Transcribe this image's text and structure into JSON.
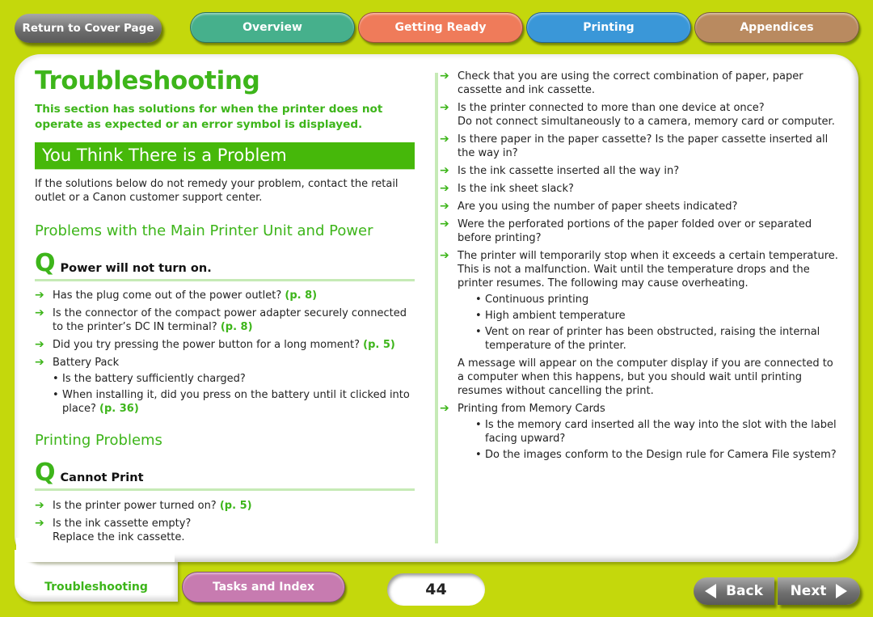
{
  "nav": {
    "return_cover": "Return to Cover Page",
    "tabs": [
      {
        "label": "Overview",
        "color": "#46b08c"
      },
      {
        "label": "Getting Ready",
        "color": "#ef7b5a"
      },
      {
        "label": "Printing",
        "color": "#3a97d8"
      },
      {
        "label": "Appendices",
        "color": "#b98a60"
      }
    ]
  },
  "page": {
    "title": "Troubleshooting",
    "intro": "This section has solutions for when the printer does not operate as expected or an error symbol is displayed.",
    "banner": "You Think There is a Problem",
    "note": "If the solutions below do not remedy your problem, contact the retail outlet or a Canon customer support center.",
    "accent_color": "#3db51a"
  },
  "section1": {
    "heading": "Problems with the Main Printer Unit and Power",
    "question": "Power will not turn on.",
    "items": [
      {
        "text": "Has the plug come out of the power outlet?",
        "ref": "(p. 8)"
      },
      {
        "text": "Is the connector of the compact power adapter securely connected to the printer’s DC IN terminal?",
        "ref": "(p. 8)"
      },
      {
        "text": "Did you try pressing the power button for a long moment?",
        "ref": "(p. 5)"
      },
      {
        "text": "Battery Pack"
      }
    ],
    "battery_bullets": [
      {
        "text": "Is the battery sufficiently charged?"
      },
      {
        "text": "When installing it, did you press on the battery until it clicked into place?",
        "ref": "(p. 36)"
      }
    ]
  },
  "section2": {
    "heading": "Printing Problems",
    "question": "Cannot Print",
    "items": [
      {
        "text": "Is the printer power turned on?",
        "ref": "(p. 5)"
      },
      {
        "text": "Is the ink cassette empty?",
        "sub": "Replace the ink cassette."
      }
    ]
  },
  "right": {
    "items": [
      {
        "text": "Check that you are using the correct combination of paper, paper cassette and ink cassette."
      },
      {
        "text": "Is the printer connected to more than one device at once?",
        "sub": "Do not connect simultaneously to a camera, memory card or computer."
      },
      {
        "text": "Is there paper in the paper cassette? Is the paper cassette inserted all the way in?"
      },
      {
        "text": "Is the ink cassette inserted all the way in?"
      },
      {
        "text": "Is the ink sheet slack?"
      },
      {
        "text": "Are you using the number of paper sheets indicated?"
      },
      {
        "text": "Were the perforated portions of the paper folded over or separated before printing?"
      },
      {
        "text": "The printer will temporarily stop when it exceeds a certain temperature. This is not a malfunction. Wait until the temperature drops and the printer resumes. The following may cause overheating."
      }
    ],
    "overheat_bullets": [
      "Continuous printing",
      "High ambient temperature",
      "Vent on rear of printer has been obstructed, raising the internal temperature of the printer."
    ],
    "overheat_note": "A message will appear on the computer display if you are connected to a computer when this happens, but you should wait until printing resumes without cancelling the print.",
    "memory_item": "Printing from Memory Cards",
    "memory_bullets": [
      "Is the memory card inserted all the way into the slot with the label facing upward?",
      "Do the images conform to the Design rule for Camera File system?"
    ]
  },
  "footer": {
    "current_tab": "Troubleshooting",
    "tasks_index": "Tasks and Index",
    "page_number": "44",
    "back": "Back",
    "next": "Next"
  },
  "icons": {
    "arrow": "➔",
    "bullet": "•",
    "q_mark": "Q"
  }
}
